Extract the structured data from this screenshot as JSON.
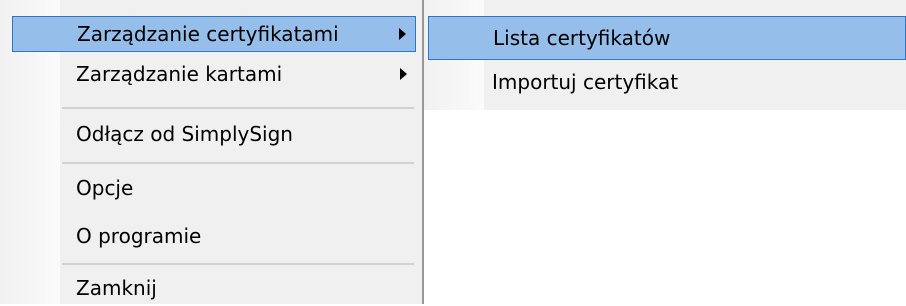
{
  "main_menu": {
    "items": [
      {
        "label": "Zarządzanie certyfikatami",
        "has_submenu": true,
        "highlighted": true
      },
      {
        "label": "Zarządzanie kartami",
        "has_submenu": true,
        "highlighted": false
      },
      {
        "label": "Odłącz od SimplySign",
        "has_submenu": false,
        "highlighted": false
      },
      {
        "label": "Opcje",
        "has_submenu": false,
        "highlighted": false
      },
      {
        "label": "O programie",
        "has_submenu": false,
        "highlighted": false
      },
      {
        "label": "Zamknij",
        "has_submenu": false,
        "highlighted": false
      }
    ]
  },
  "sub_menu": {
    "items": [
      {
        "label": "Lista certyfikatów",
        "highlighted": true
      },
      {
        "label": "Importuj certyfikat",
        "highlighted": false
      }
    ]
  },
  "colors": {
    "menu_background": "#f0f0f0",
    "highlight_background": "#95bfea",
    "highlight_border": "#2e75c4",
    "separator": "#d2d2d2"
  },
  "icons": {
    "submenu_arrow": "chevron-right-icon"
  }
}
